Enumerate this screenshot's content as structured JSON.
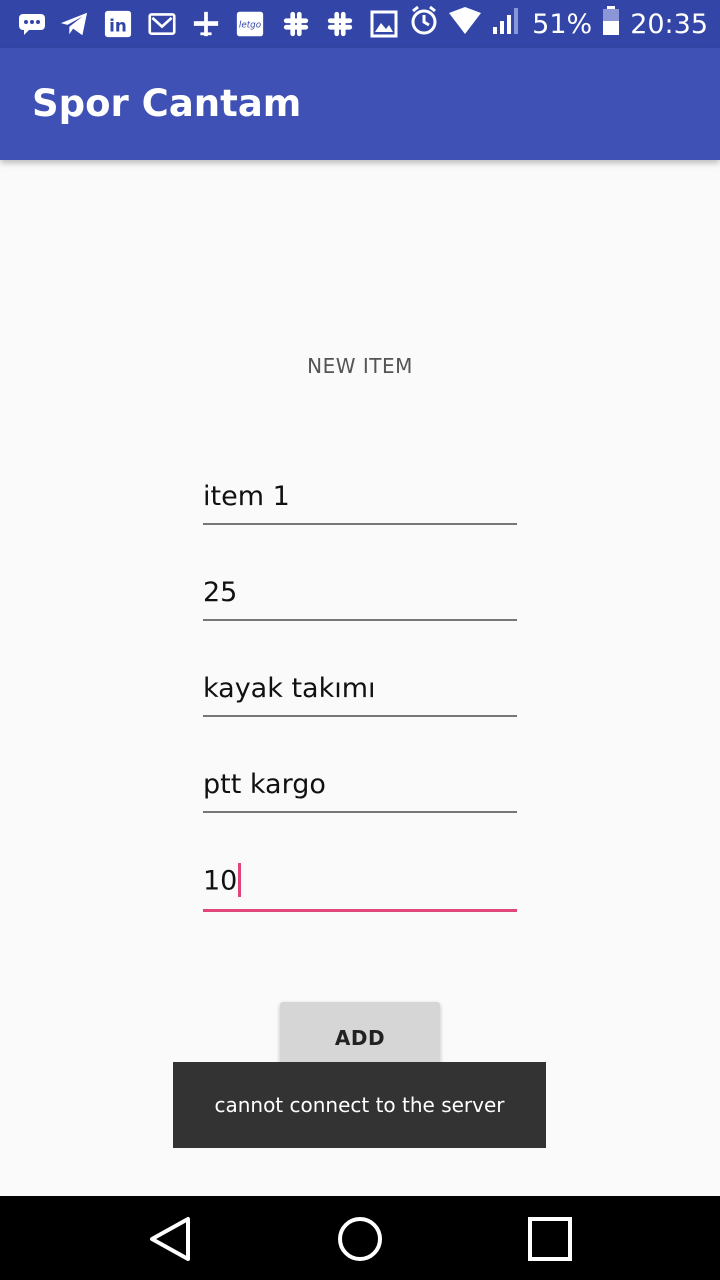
{
  "status_bar": {
    "notification_icons": [
      "chat-bubble-icon",
      "telegram-icon",
      "linkedin-icon",
      "mail-icon",
      "flight-icon",
      "letgo-icon",
      "slack-icon",
      "slack-icon",
      "image-icon"
    ],
    "letgo_label": "letgo",
    "battery_percent": "51%",
    "time": "20:35"
  },
  "app_bar": {
    "title": "Spor Cantam"
  },
  "form": {
    "section_label": "NEW ITEM",
    "fields": [
      {
        "value": "item 1"
      },
      {
        "value": "25"
      },
      {
        "value": "kayak takımı"
      },
      {
        "value": "ptt kargo"
      },
      {
        "value": "10"
      }
    ],
    "add_button_label": "ADD"
  },
  "toast": {
    "message": "cannot connect to the server"
  },
  "colors": {
    "status_bar": "#3346a8",
    "app_bar": "#3f51b5",
    "accent": "#e0457b",
    "toast_bg": "#333333"
  }
}
